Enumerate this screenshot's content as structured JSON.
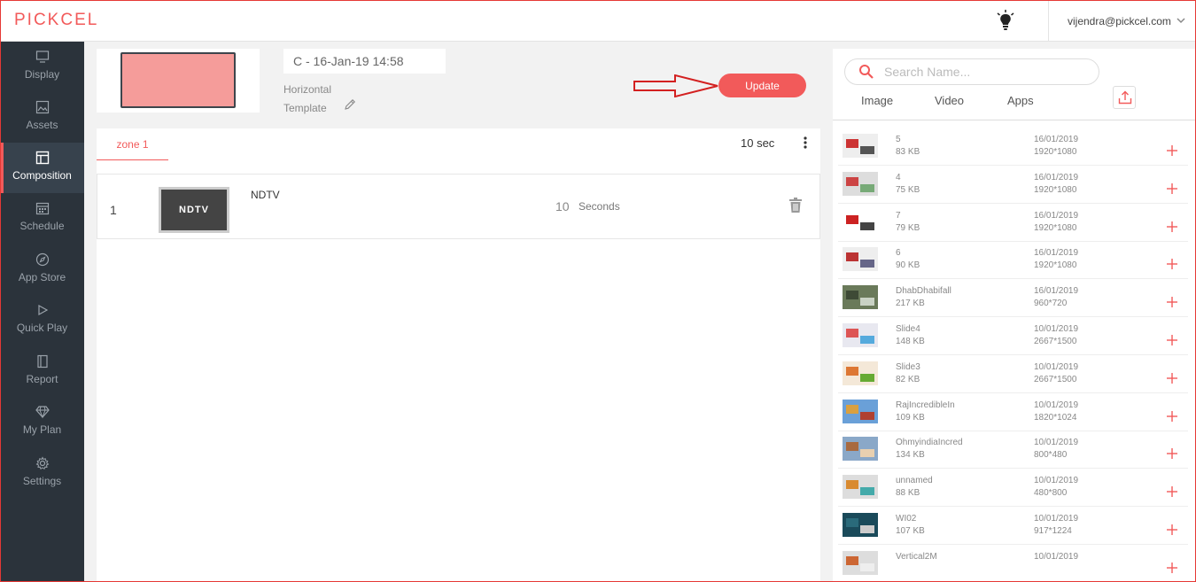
{
  "header": {
    "logo": "PICKCEL",
    "user_email": "vijendra@pickcel.com"
  },
  "sidebar": {
    "items": [
      {
        "label": "Display",
        "icon": "monitor-icon",
        "active": false
      },
      {
        "label": "Assets",
        "icon": "image-icon",
        "active": false
      },
      {
        "label": "Composition",
        "icon": "layout-icon",
        "active": true
      },
      {
        "label": "Schedule",
        "icon": "calendar-icon",
        "active": false
      },
      {
        "label": "App Store",
        "icon": "compass-icon",
        "active": false
      },
      {
        "label": "Quick Play",
        "icon": "play-icon",
        "active": false
      },
      {
        "label": "Report",
        "icon": "report-icon",
        "active": false
      },
      {
        "label": "My Plan",
        "icon": "diamond-icon",
        "active": false
      },
      {
        "label": "Settings",
        "icon": "gear-icon",
        "active": false
      }
    ]
  },
  "composition": {
    "name": "C - 16-Jan-19 14:58",
    "orientation": "Horizontal",
    "template_label": "Template",
    "update_label": "Update"
  },
  "zone": {
    "tab_label": "zone 1",
    "duration": "10 sec",
    "rows": [
      {
        "index": "1",
        "thumb_text": "NDTV",
        "name": "NDTV",
        "seconds": "10",
        "seconds_label": "Seconds"
      }
    ]
  },
  "library": {
    "search_placeholder": "Search Name...",
    "tabs": [
      "Image",
      "Video",
      "Apps"
    ],
    "items": [
      {
        "name": "5",
        "size": "83 KB",
        "date": "16/01/2019",
        "resolution": "1920*1080",
        "thumb": [
          "#eee",
          "#c33",
          "#555"
        ]
      },
      {
        "name": "4",
        "size": "75 KB",
        "date": "16/01/2019",
        "resolution": "1920*1080",
        "thumb": [
          "#ddd",
          "#c44",
          "#7a7"
        ]
      },
      {
        "name": "7",
        "size": "79 KB",
        "date": "16/01/2019",
        "resolution": "1920*1080",
        "thumb": [
          "#fff",
          "#c22",
          "#444"
        ]
      },
      {
        "name": "6",
        "size": "90 KB",
        "date": "16/01/2019",
        "resolution": "1920*1080",
        "thumb": [
          "#eee",
          "#b33",
          "#668"
        ]
      },
      {
        "name": "DhabDhabifall",
        "size": "217 KB",
        "date": "16/01/2019",
        "resolution": "960*720",
        "thumb": [
          "#6a7a5a",
          "#3e4a36",
          "#c9d2c4"
        ]
      },
      {
        "name": "Slide4",
        "size": "148 KB",
        "date": "10/01/2019",
        "resolution": "2667*1500",
        "thumb": [
          "#e8e8f0",
          "#d55",
          "#5ad"
        ]
      },
      {
        "name": "Slide3",
        "size": "82 KB",
        "date": "10/01/2019",
        "resolution": "2667*1500",
        "thumb": [
          "#f4e8d8",
          "#d73",
          "#6a3"
        ]
      },
      {
        "name": "RajIncredibleIn",
        "size": "109 KB",
        "date": "10/01/2019",
        "resolution": "1820*1024",
        "thumb": [
          "#6aa0d8",
          "#d9a040",
          "#b04030"
        ]
      },
      {
        "name": "OhmyindiaIncred",
        "size": "134 KB",
        "date": "10/01/2019",
        "resolution": "800*480",
        "thumb": [
          "#8aa8c8",
          "#a86a40",
          "#e8d0b0"
        ]
      },
      {
        "name": "unnamed",
        "size": "88 KB",
        "date": "10/01/2019",
        "resolution": "480*800",
        "thumb": [
          "#ddd",
          "#d98a30",
          "#4aa"
        ]
      },
      {
        "name": "WI02",
        "size": "107 KB",
        "date": "10/01/2019",
        "resolution": "917*1224",
        "thumb": [
          "#1a4a5a",
          "#2a6a7a",
          "#ccc"
        ]
      },
      {
        "name": "Vertical2M",
        "size": "",
        "date": "10/01/2019",
        "resolution": "",
        "thumb": [
          "#ddd",
          "#c63",
          "#eee"
        ]
      }
    ]
  },
  "colors": {
    "accent": "#f25a5a",
    "sidebar_bg": "#2b333b",
    "sidebar_active": "#37424d",
    "template_preview": "#f59c9a"
  }
}
